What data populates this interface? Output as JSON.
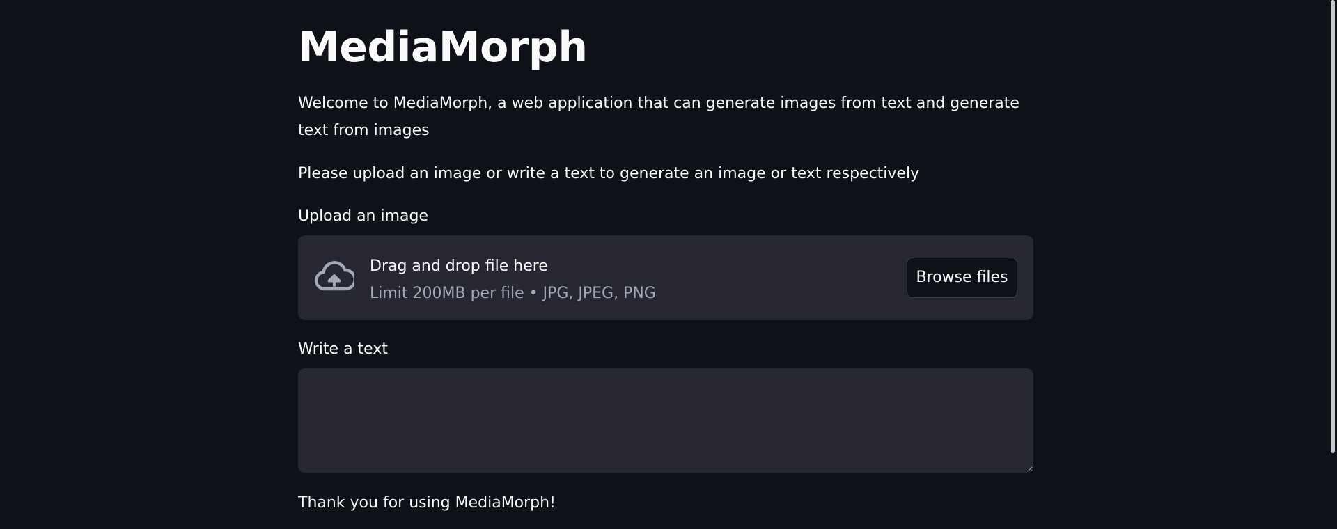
{
  "app": {
    "title": "MediaMorph",
    "intro": "Welcome to MediaMorph, a web application that can generate images from text and generate text from images",
    "instructions": "Please upload an image or write a text to generate an image or text respectively",
    "footer": "Thank you for using MediaMorph!"
  },
  "upload": {
    "label": "Upload an image",
    "drag_text": "Drag and drop file here",
    "limit_text": "Limit 200MB per file • JPG, JPEG, PNG",
    "browse_label": "Browse files",
    "icon": "cloud-upload-icon"
  },
  "text_input": {
    "label": "Write a text",
    "value": "",
    "placeholder": ""
  },
  "colors": {
    "background": "#0e1117",
    "surface": "#262730",
    "text": "#fafafa",
    "muted_text": "#a3a8b8"
  }
}
